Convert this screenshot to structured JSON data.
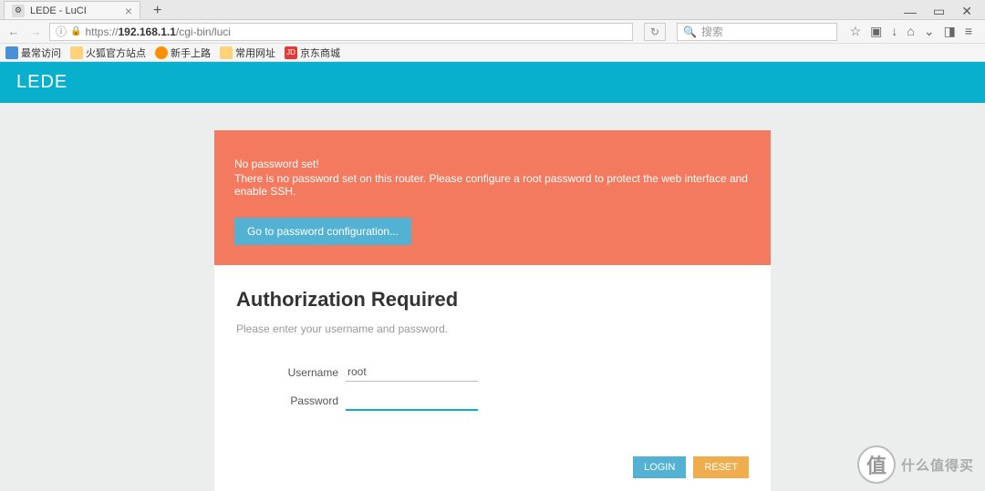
{
  "browser": {
    "tab_title": "LEDE - LuCI",
    "url_prefix": "https://",
    "url_host": "192.168.1.1",
    "url_path": "/cgi-bin/luci",
    "search_placeholder": "搜索"
  },
  "bookmarks": {
    "b0": "最常访问",
    "b1": "火狐官方站点",
    "b2": "新手上路",
    "b3": "常用网址",
    "b4": "京东商城"
  },
  "header": {
    "brand": "LEDE"
  },
  "warning": {
    "title": "No password set!",
    "message": "There is no password set on this router. Please configure a root password to protect the web interface and enable SSH.",
    "button": "Go to password configuration..."
  },
  "auth": {
    "heading": "Authorization Required",
    "hint": "Please enter your username and password.",
    "username_label": "Username",
    "username_value": "root",
    "password_label": "Password",
    "password_value": "",
    "login_btn": "LOGIN",
    "reset_btn": "RESET"
  },
  "watermark": {
    "char": "值",
    "text": "什么值得买"
  }
}
